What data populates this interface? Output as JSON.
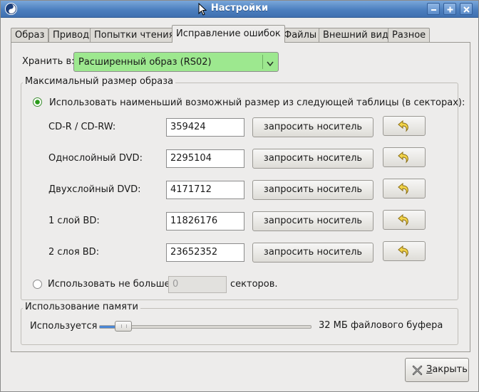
{
  "window": {
    "title": "Настройки"
  },
  "tabs": [
    {
      "label": "Образ",
      "active": false
    },
    {
      "label": "Привод",
      "active": false
    },
    {
      "label": "Попытки чтения",
      "active": false
    },
    {
      "label": "Исправление ошибок",
      "active": true
    },
    {
      "label": "Файлы",
      "active": false
    },
    {
      "label": "Внешний вид",
      "active": false
    },
    {
      "label": "Разное",
      "active": false
    }
  ],
  "store": {
    "label": "Хранить в:",
    "value": "Расширенный образ (RS02)",
    "accent_color": "#9de88f"
  },
  "max_size": {
    "title": "Максимальный размер образа",
    "use_table_label": "Использовать наименьший возможный размер из следующей таблицы (в секторах):",
    "use_table_selected": true,
    "rows": [
      {
        "label": "CD-R / CD-RW:",
        "value": "359424",
        "query_label": "запросить носитель"
      },
      {
        "label": "Однослойный DVD:",
        "value": "2295104",
        "query_label": "запросить носитель"
      },
      {
        "label": "Двухслойный DVD:",
        "value": "4171712",
        "query_label": "запросить носитель"
      },
      {
        "label": "1 слой BD:",
        "value": "11826176",
        "query_label": "запросить носитель"
      },
      {
        "label": "2 слоя BD:",
        "value": "23652352",
        "query_label": "запросить носитель"
      }
    ],
    "use_limit_label": "Использовать не больше",
    "use_limit_selected": false,
    "limit_value": "0",
    "sectors_label": "секторов."
  },
  "memory": {
    "title": "Использование памяти",
    "used_label": "Используется",
    "slider_fraction": 0.08,
    "value_text": "32 МБ файлового буфера"
  },
  "close_button": {
    "label": "Закрыть"
  }
}
